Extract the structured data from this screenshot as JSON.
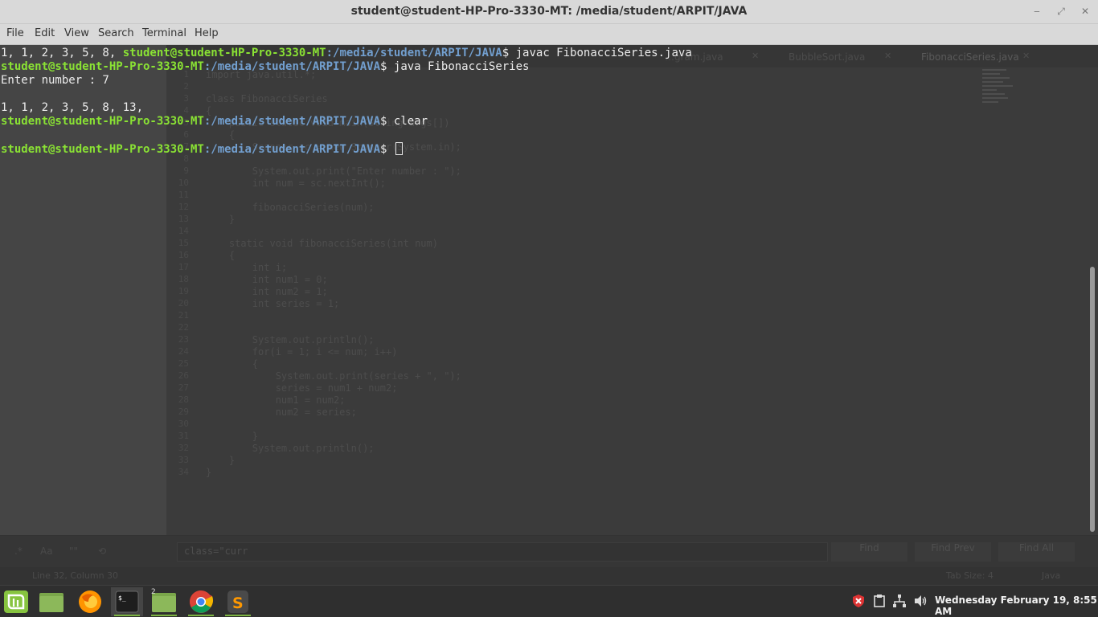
{
  "window": {
    "title": "student@student-HP-Pro-3330-MT: /media/student/ARPIT/JAVA",
    "controls": {
      "minimize": "‒",
      "maximize": "⤢",
      "close": "✕"
    }
  },
  "menu": [
    "File",
    "Edit",
    "View",
    "Search",
    "Terminal",
    "Help"
  ],
  "terminal": {
    "lines": [
      {
        "pre": "1, 1, 2, 3, 5, 8, ",
        "user": "student@student-HP-Pro-3330-MT",
        "path": ":/media/student/ARPIT/JAVA",
        "cmd": "$ javac FibonacciSeries.java"
      },
      {
        "pre": "",
        "user": "student@student-HP-Pro-3330-MT",
        "path": ":/media/student/ARPIT/JAVA",
        "cmd": "$ java FibonacciSeries"
      },
      {
        "pre": "Enter number : 7",
        "user": "",
        "path": "",
        "cmd": ""
      },
      {
        "pre": "",
        "user": "",
        "path": "",
        "cmd": ""
      },
      {
        "pre": "1, 1, 2, 3, 5, 8, 13, ",
        "user": "",
        "path": "",
        "cmd": ""
      },
      {
        "pre": "",
        "user": "student@student-HP-Pro-3330-MT",
        "path": ":/media/student/ARPIT/JAVA",
        "cmd": "$ clear"
      },
      {
        "pre": "",
        "user": "",
        "path": "",
        "cmd": ""
      },
      {
        "pre": "",
        "user": "student@student-HP-Pro-3330-MT",
        "path": ":/media/student/ARPIT/JAVA",
        "cmd": "$ "
      }
    ]
  },
  "background_editor": {
    "tabs": [
      "…gram.java",
      "BubbleSort.java",
      "FibonacciSeries.java"
    ],
    "close_glyph": "✕",
    "code": [
      {
        "n": "1",
        "t": "import java.util.*;"
      },
      {
        "n": "2",
        "t": ""
      },
      {
        "n": "3",
        "t": "class FibonacciSeries"
      },
      {
        "n": "4",
        "t": "{"
      },
      {
        "n": "5",
        "t": "    public static void main(String args[])"
      },
      {
        "n": "6",
        "t": "    {"
      },
      {
        "n": "7",
        "t": "        Scanner sc = new Scanner(System.in);"
      },
      {
        "n": "8",
        "t": ""
      },
      {
        "n": "9",
        "t": "        System.out.print(\"Enter number : \");"
      },
      {
        "n": "10",
        "t": "        int num = sc.nextInt();"
      },
      {
        "n": "11",
        "t": ""
      },
      {
        "n": "12",
        "t": "        fibonacciSeries(num);"
      },
      {
        "n": "13",
        "t": "    }"
      },
      {
        "n": "14",
        "t": ""
      },
      {
        "n": "15",
        "t": "    static void fibonacciSeries(int num)"
      },
      {
        "n": "16",
        "t": "    {"
      },
      {
        "n": "17",
        "t": "        int i;"
      },
      {
        "n": "18",
        "t": "        int num1 = 0;"
      },
      {
        "n": "19",
        "t": "        int num2 = 1;"
      },
      {
        "n": "20",
        "t": "        int series = 1;"
      },
      {
        "n": "21",
        "t": ""
      },
      {
        "n": "22",
        "t": ""
      },
      {
        "n": "23",
        "t": "        System.out.println();"
      },
      {
        "n": "24",
        "t": "        for(i = 1; i <= num; i++)"
      },
      {
        "n": "25",
        "t": "        {"
      },
      {
        "n": "26",
        "t": "            System.out.print(series + \", \");"
      },
      {
        "n": "27",
        "t": "            series = num1 + num2;"
      },
      {
        "n": "28",
        "t": "            num1 = num2;"
      },
      {
        "n": "29",
        "t": "            num2 = series;"
      },
      {
        "n": "30",
        "t": ""
      },
      {
        "n": "31",
        "t": "        }"
      },
      {
        "n": "32",
        "t": "        System.out.println();"
      },
      {
        "n": "33",
        "t": "    }"
      },
      {
        "n": "34",
        "t": "}"
      }
    ],
    "find": {
      "value": "class=\"curr",
      "find_label": "Find",
      "find_prev_label": "Find Prev",
      "find_all_label": "Find All",
      "icons": {
        "regex": ".*",
        "case": "Aa",
        "word": "\"\"",
        "wrap": "⟲"
      }
    },
    "status": {
      "position": "Line 32, Column 30",
      "tab_size": "Tab Size: 4",
      "syntax": "Java"
    }
  },
  "taskbar": {
    "apps": [
      {
        "name": "menu",
        "badge": ""
      },
      {
        "name": "files",
        "badge": ""
      },
      {
        "name": "firefox",
        "badge": ""
      },
      {
        "name": "terminal",
        "badge": ""
      },
      {
        "name": "files-2",
        "badge": "2"
      },
      {
        "name": "chrome",
        "badge": ""
      },
      {
        "name": "sublime",
        "badge": ""
      }
    ],
    "clock": "Wednesday February 19,  8:55 AM"
  }
}
